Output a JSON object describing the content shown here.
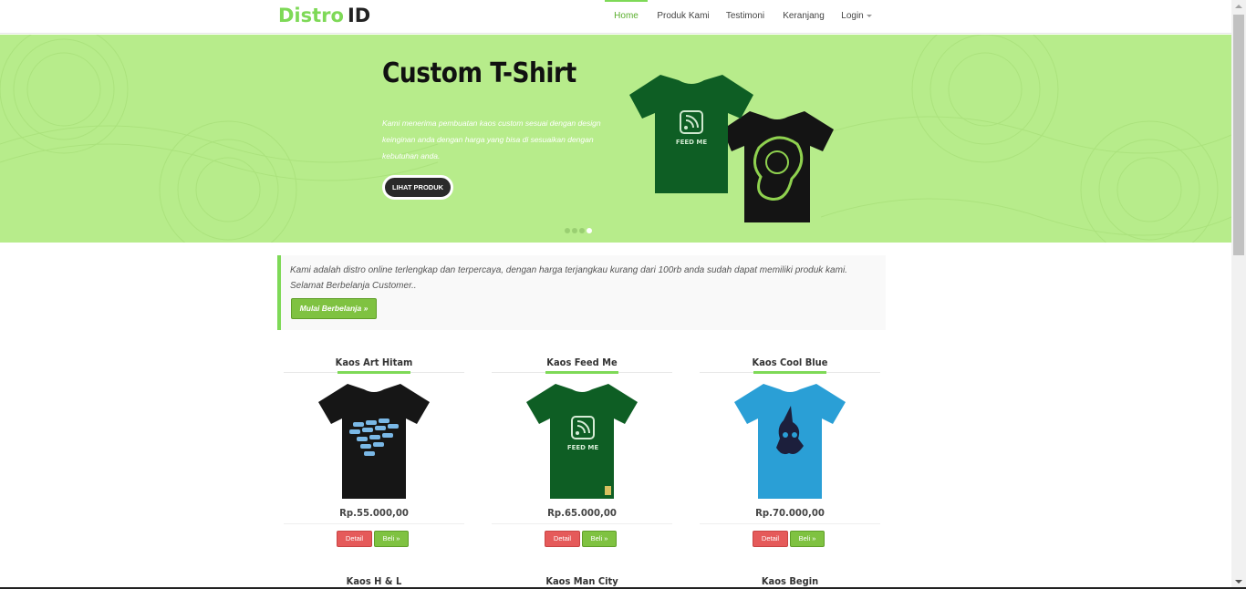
{
  "brand": {
    "part1": "Distro",
    "part2": "ID"
  },
  "nav": [
    {
      "label": "Home",
      "active": true
    },
    {
      "label": "Produk Kami",
      "active": false
    },
    {
      "label": "Testimoni",
      "active": false
    },
    {
      "label": "Keranjang",
      "active": false
    },
    {
      "label": "Login",
      "active": false,
      "dropdown": true
    }
  ],
  "hero": {
    "title": "Custom T-Shirt",
    "description": "Kami menerima pembuatan kaos custom sesuai dengan design keinginan anda dengan harga yang bisa di sesuaikan dengan kebutuhan anda.",
    "button": "LIHAT PRODUK",
    "shirt_front_text": "FEED ME",
    "slides": 4,
    "active_slide": 4
  },
  "intro": {
    "text": "Kami adalah distro online terlengkap dan terpercaya, dengan harga terjangkau kurang dari 100rb anda sudah dapat memiliki produk kami. Selamat Berbelanja Customer..",
    "button": "Mulai Berbelanja »"
  },
  "products": [
    {
      "name": "Kaos Art Hitam",
      "price": "Rp.55.000,00",
      "detail": "Detail",
      "buy": "Beli »",
      "shirt_color": "#161616",
      "print": "art"
    },
    {
      "name": "Kaos Feed Me",
      "price": "Rp.65.000,00",
      "detail": "Detail",
      "buy": "Beli »",
      "shirt_color": "#0e5e24",
      "print": "FEED ME"
    },
    {
      "name": "Kaos Cool Blue",
      "price": "Rp.70.000,00",
      "detail": "Detail",
      "buy": "Beli »",
      "shirt_color": "#2a9fd6",
      "print": "bunny"
    },
    {
      "name": "Kaos H & L"
    },
    {
      "name": "Kaos Man City"
    },
    {
      "name": "Kaos Begin"
    }
  ],
  "colors": {
    "accent": "#7ed957",
    "hero_bg": "#b7ec8b",
    "button_green": "#7fc241",
    "button_red": "#e55a5a"
  }
}
